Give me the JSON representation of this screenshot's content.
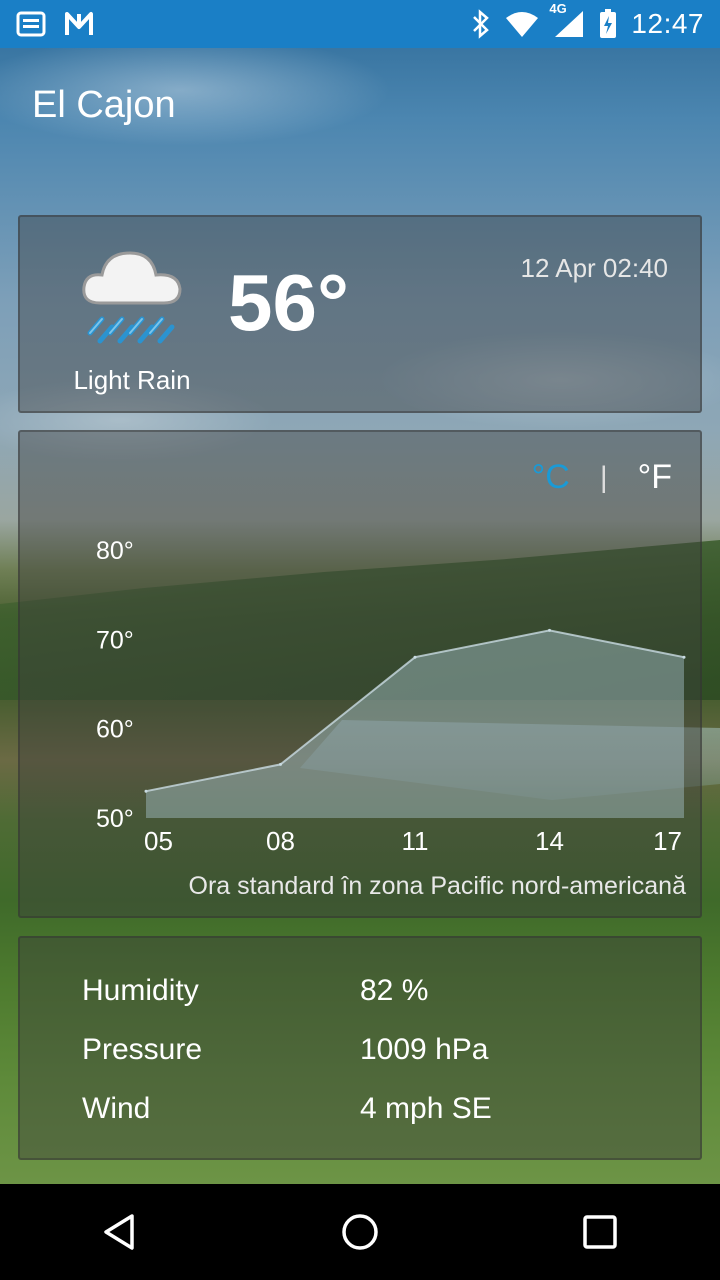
{
  "status_bar": {
    "time": "12:47",
    "network": "4G",
    "icons": [
      "notes-icon",
      "n-app-icon",
      "bluetooth-icon",
      "wifi-icon",
      "cell-signal-icon",
      "battery-charging-icon"
    ]
  },
  "city": "El Cajon",
  "current": {
    "temperature": "56°",
    "condition": "Light Rain",
    "datetime": "12 Apr 02:40",
    "icon": "cloud-rain-icon"
  },
  "units": {
    "celsius": "°C",
    "separator": "|",
    "fahrenheit": "°F",
    "selected": "°C",
    "selected_color": "#1a9ad6"
  },
  "chart_data": {
    "type": "area",
    "x": [
      "05",
      "08",
      "11",
      "14",
      "17"
    ],
    "values": [
      53,
      56,
      68,
      71,
      68
    ],
    "y_ticks": [
      "80°",
      "70°",
      "60°",
      "50°"
    ],
    "ylim": [
      50,
      80
    ],
    "grid": false,
    "fill_color": "#a7c3cd"
  },
  "timezone_label": "Ora standard în zona Pacific nord-americană",
  "details": {
    "humidity_label": "Humidity",
    "humidity_value": "82 %",
    "pressure_label": "Pressure",
    "pressure_value": "1009 hPa",
    "wind_label": "Wind",
    "wind_value": "4 mph SE"
  },
  "nav": [
    "back-icon",
    "home-icon",
    "recents-icon"
  ]
}
